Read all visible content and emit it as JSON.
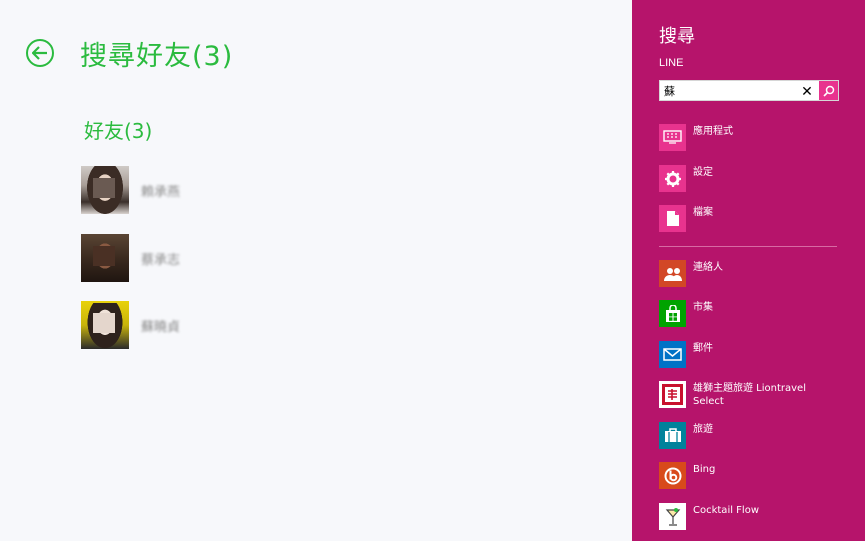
{
  "main": {
    "title": "搜尋好友(3)",
    "section_title": "好友(3)",
    "friends": [
      {
        "name": "賴承燕"
      },
      {
        "name": "蔡承志"
      },
      {
        "name": "蘇曉貞"
      }
    ]
  },
  "charm": {
    "title": "搜尋",
    "scope": "LINE",
    "search": {
      "value": "蘇",
      "clear": "✕"
    },
    "categories": [
      {
        "label": "應用程式",
        "icon": "keyboard-icon",
        "color": "#e8338e"
      },
      {
        "label": "設定",
        "icon": "gear-icon",
        "color": "#e8338e"
      },
      {
        "label": "檔案",
        "icon": "document-icon",
        "color": "#e8338e"
      }
    ],
    "apps": [
      {
        "label": "連絡人",
        "icon": "people-icon",
        "color": "#d24726"
      },
      {
        "label": "市集",
        "icon": "store-icon",
        "color": "#00a300"
      },
      {
        "label": "郵件",
        "icon": "mail-icon",
        "color": "#0072c6"
      },
      {
        "label": "雄獅主題旅遊 Liontravel Select",
        "icon": "liontravel-icon",
        "color": "#ffffff"
      },
      {
        "label": "旅遊",
        "icon": "suitcase-icon",
        "color": "#00829b"
      },
      {
        "label": "Bing",
        "icon": "bing-icon",
        "color": "#d84a1b"
      },
      {
        "label": "Cocktail Flow",
        "icon": "cocktail-icon",
        "color": "#ffffff"
      }
    ]
  }
}
